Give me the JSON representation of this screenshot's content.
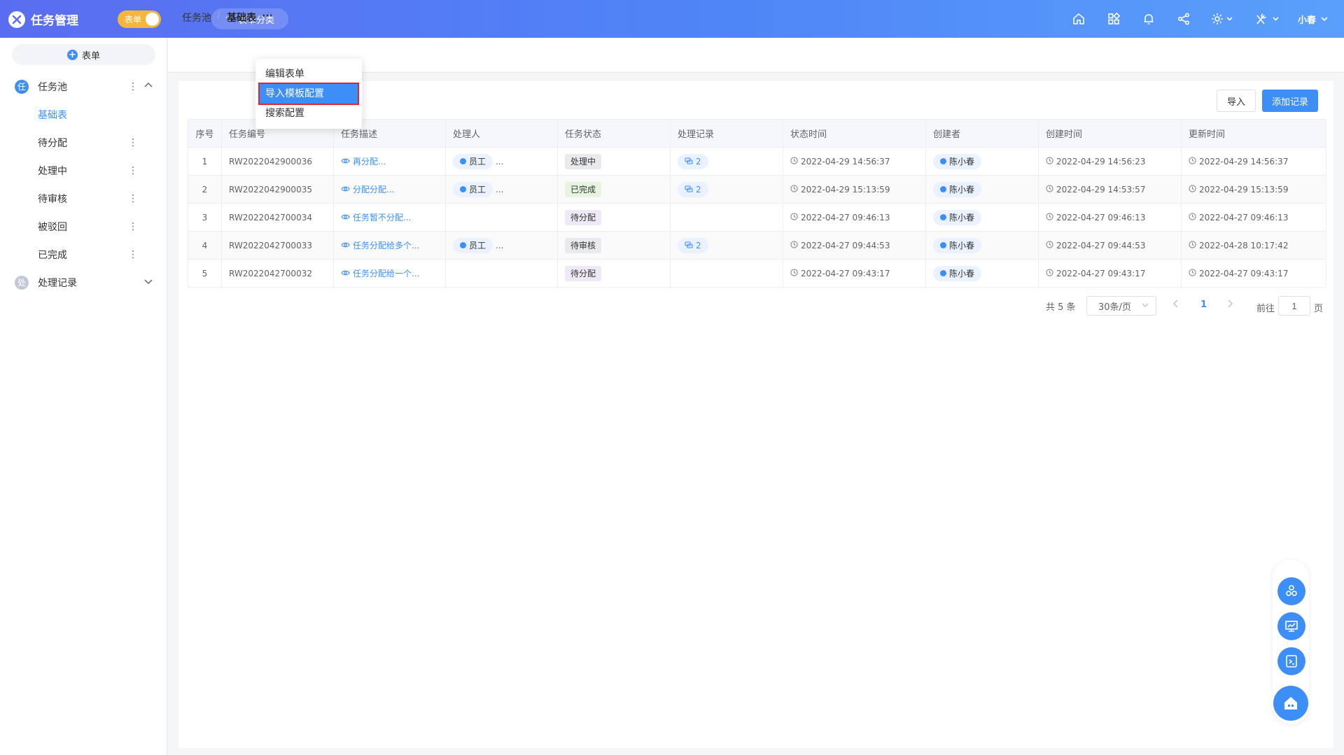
{
  "header": {
    "app_title": "任务管理",
    "mode_toggle_label": "表单",
    "category_button_label": "表单分类",
    "user_name": "小春",
    "icons": [
      "home-icon",
      "apps-icon",
      "bell-icon",
      "share-icon",
      "settings-icon",
      "tools-icon"
    ]
  },
  "sidebar": {
    "add_form_label": "表单",
    "group_task_pool": {
      "badge": "任",
      "label": "任务池"
    },
    "items": [
      {
        "label": "基础表",
        "active": true
      },
      {
        "label": "待分配"
      },
      {
        "label": "处理中"
      },
      {
        "label": "待审核"
      },
      {
        "label": "被驳回"
      },
      {
        "label": "已完成"
      }
    ],
    "group_records": {
      "badge": "处",
      "label": "处理记录"
    }
  },
  "breadcrumb": {
    "root": "任务池",
    "separator": "/",
    "current": "基础表",
    "more": "···"
  },
  "dropdown": {
    "items": [
      "编辑表单",
      "导入模板配置",
      "搜索配置"
    ],
    "highlighted_index": 1
  },
  "toolbar": {
    "import_label": "导入",
    "add_record_label": "添加记录"
  },
  "table": {
    "columns": [
      "序号",
      "任务编号",
      "任务描述",
      "处理人",
      "任务状态",
      "处理记录",
      "状态时间",
      "创建者",
      "创建时间",
      "更新时间"
    ],
    "rows": [
      {
        "no": "1",
        "code": "RW2022042900036",
        "desc": "再分配...",
        "handler": "员工",
        "handler_more": "...",
        "status": "处理中",
        "status_color": "#e8eaed",
        "records": "2",
        "status_time": "2022-04-29 14:56:37",
        "creator": "陈小春",
        "created": "2022-04-29 14:56:23",
        "updated": "2022-04-29 14:56:37"
      },
      {
        "no": "2",
        "code": "RW2022042900035",
        "desc": "分配分配...",
        "handler": "员工",
        "handler_more": "...",
        "status": "已完成",
        "status_color": "#e6f4e0",
        "records": "2",
        "status_time": "2022-04-29 15:13:59",
        "creator": "陈小春",
        "created": "2022-04-29 14:53:57",
        "updated": "2022-04-29 15:13:59"
      },
      {
        "no": "3",
        "code": "RW2022042700034",
        "desc": "任务暂不分配...",
        "handler": "",
        "handler_more": "",
        "status": "待分配",
        "status_color": "#efe9f7",
        "records": "",
        "status_time": "2022-04-27 09:46:13",
        "creator": "陈小春",
        "created": "2022-04-27 09:46:13",
        "updated": "2022-04-27 09:46:13"
      },
      {
        "no": "4",
        "code": "RW2022042700033",
        "desc": "任务分配给多个...",
        "handler": "员工",
        "handler_more": "...",
        "status": "待审核",
        "status_color": "#e8eaed",
        "records": "2",
        "status_time": "2022-04-27 09:44:53",
        "creator": "陈小春",
        "created": "2022-04-27 09:44:53",
        "updated": "2022-04-28 10:17:42"
      },
      {
        "no": "5",
        "code": "RW2022042700032",
        "desc": "任务分配给一个...",
        "handler": "",
        "handler_more": "",
        "status": "待分配",
        "status_color": "#efe9f7",
        "records": "",
        "status_time": "2022-04-27 09:43:17",
        "creator": "陈小春",
        "created": "2022-04-27 09:43:17",
        "updated": "2022-04-27 09:43:17"
      }
    ]
  },
  "pagination": {
    "total": "共 5 条",
    "page_size": "30条/页",
    "current_page": "1",
    "goto_label": "前往",
    "goto_value": "1",
    "page_suffix": "页"
  },
  "floating_tools": [
    "flow-settings-icon",
    "dashboard-icon",
    "script-icon",
    "home-app-icon"
  ]
}
